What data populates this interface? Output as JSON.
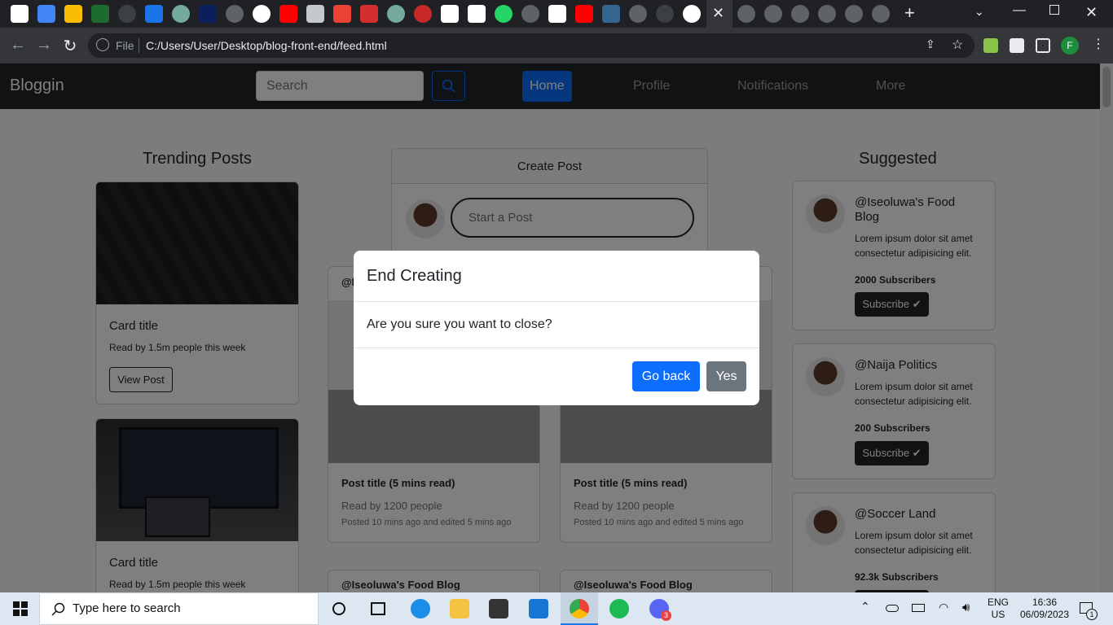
{
  "browser": {
    "file_label": "File",
    "url": "C:/Users/User/Desktop/blog-front-end/feed.html",
    "profile_initial": "F"
  },
  "site": {
    "brand": "Bloggin",
    "search_placeholder": "Search",
    "nav": [
      "Home",
      "Profile",
      "Notifications",
      "More"
    ]
  },
  "trending": {
    "title": "Trending Posts",
    "cards": [
      {
        "title": "Card title",
        "meta": "Read by 1.5m people this week",
        "button": "View Post"
      },
      {
        "title": "Card title",
        "meta": "Read by 1.5m people this week"
      }
    ]
  },
  "create_post": {
    "header": "Create Post",
    "placeholder": "Start a Post"
  },
  "feed": {
    "posts": [
      {
        "author": "@I",
        "title": "Post title (5 mins read)",
        "reads": "Read by 1200 people",
        "posted": "Posted 10 mins ago and edited 5 mins ago"
      },
      {
        "title": "Post title (5 mins read)",
        "reads": "Read by 1200 people",
        "posted": "Posted 10 mins ago and edited 5 mins ago"
      },
      {
        "author": "@Iseoluwa's Food Blog"
      },
      {
        "author": "@Iseoluwa's Food Blog"
      }
    ]
  },
  "suggested": {
    "title": "Suggested",
    "items": [
      {
        "name": "@Iseoluwa's Food Blog",
        "desc": "Lorem ipsum dolor sit amet consectetur adipisicing elit.",
        "subs": "2000 Subscribers",
        "button": "Subscribe"
      },
      {
        "name": "@Naija Politics",
        "desc": "Lorem ipsum dolor sit amet consectetur adipisicing elit.",
        "subs": "200 Subscribers",
        "button": "Subscribe"
      },
      {
        "name": "@Soccer Land",
        "desc": "Lorem ipsum dolor sit amet consectetur adipisicing elit.",
        "subs": "92.3k Subscribers"
      }
    ]
  },
  "modal": {
    "title": "End Creating",
    "body": "Are you sure you want to close?",
    "back": "Go back",
    "yes": "Yes"
  },
  "taskbar": {
    "search_placeholder": "Type here to search",
    "lang1": "ENG",
    "lang2": "US",
    "time": "16:36",
    "date": "06/09/2023",
    "discord_badge": "3",
    "notif_badge": "1"
  },
  "colors": {
    "primary": "#0d6efd",
    "secondary": "#6c757d",
    "dark": "#212529"
  }
}
